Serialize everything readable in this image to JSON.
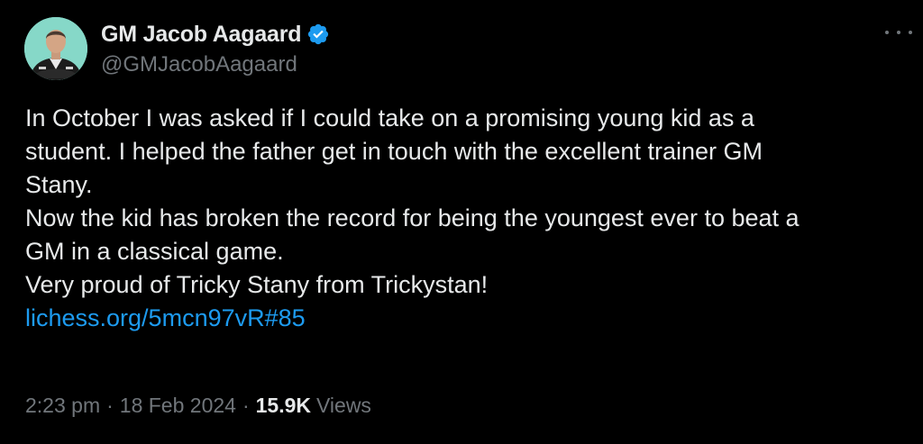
{
  "author": {
    "display_name": "GM Jacob Aagaard",
    "handle": "@GMJacobAagaard",
    "verified": true,
    "avatar": "profile-photo"
  },
  "tweet": {
    "lines": [
      "In October I was asked if I could take on a promising young kid as a",
      "student. I helped the father get in touch with the excellent trainer GM",
      "Stany.",
      "Now the kid has broken the record for being the youngest ever to beat a",
      "GM in a classical game.",
      "Very proud of Tricky Stany from Trickystan!"
    ],
    "link": "lichess.org/5mcn97vR#85"
  },
  "meta": {
    "time": "2:23 pm",
    "separator": "·",
    "date": "18 Feb 2024",
    "views_count": "15.9K",
    "views_label": "Views"
  },
  "icons": {
    "verified": "verified-badge-icon",
    "more": "more-options-icon"
  },
  "colors": {
    "background": "#000000",
    "text": "#e7e9ea",
    "secondary": "#71767b",
    "link": "#1d9bf0"
  }
}
